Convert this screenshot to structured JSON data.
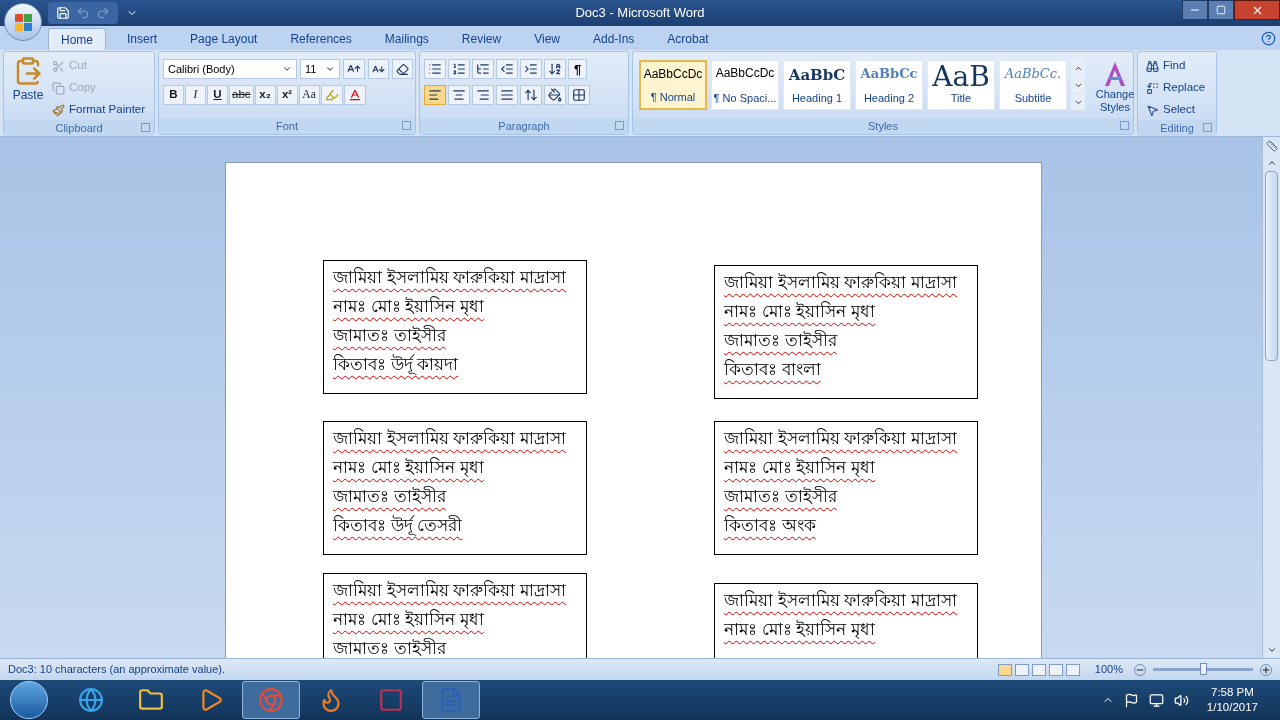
{
  "window": {
    "title": "Doc3 - Microsoft Word"
  },
  "tabs": [
    {
      "label": "Home",
      "selected": true
    },
    {
      "label": "Insert",
      "selected": false
    },
    {
      "label": "Page Layout",
      "selected": false
    },
    {
      "label": "References",
      "selected": false
    },
    {
      "label": "Mailings",
      "selected": false
    },
    {
      "label": "Review",
      "selected": false
    },
    {
      "label": "View",
      "selected": false
    },
    {
      "label": "Add-Ins",
      "selected": false
    },
    {
      "label": "Acrobat",
      "selected": false
    }
  ],
  "clipboard": {
    "label": "Clipboard",
    "paste": "Paste",
    "items": [
      {
        "label": "Cut",
        "disabled": true
      },
      {
        "label": "Copy",
        "disabled": true
      },
      {
        "label": "Format Painter",
        "disabled": false
      }
    ]
  },
  "font": {
    "label": "Font",
    "font_name": "Calibri (Body)",
    "font_size": "11",
    "format_buttons": [
      {
        "kind": "bold",
        "label": "B"
      },
      {
        "kind": "italic",
        "label": "I"
      },
      {
        "kind": "underline",
        "label": "U"
      },
      {
        "kind": "strike",
        "label": "abc"
      },
      {
        "kind": "sub",
        "label": "x₂"
      },
      {
        "kind": "sup",
        "label": "x²"
      },
      {
        "kind": "case",
        "label": "Aa"
      }
    ]
  },
  "paragraph": {
    "label": "Paragraph",
    "show_marks": "¶",
    "alignment": [
      {
        "kind": "left",
        "selected": true
      },
      {
        "kind": "center",
        "selected": false
      },
      {
        "kind": "right",
        "selected": false
      },
      {
        "kind": "justify",
        "selected": false
      }
    ]
  },
  "styles": {
    "label": "Styles",
    "change_styles": "Change Styles",
    "gallery": [
      {
        "preview": "AaBbCcDc",
        "name": "¶ Normal",
        "kind": "normal",
        "selected": true
      },
      {
        "preview": "AaBbCcDc",
        "name": "¶ No Spaci...",
        "kind": "normal",
        "selected": false
      },
      {
        "preview": "AaBbC",
        "name": "Heading 1",
        "kind": "heading1",
        "selected": false
      },
      {
        "preview": "AaBbCc",
        "name": "Heading 2",
        "kind": "heading2",
        "selected": false
      },
      {
        "preview": "AaB",
        "name": "Title",
        "kind": "title",
        "selected": false
      },
      {
        "preview": "AaBbCc.",
        "name": "Subtitle",
        "kind": "subtitle",
        "selected": false
      }
    ]
  },
  "editing": {
    "label": "Editing",
    "items": [
      {
        "kind": "find",
        "label": "Find"
      },
      {
        "kind": "replace",
        "label": "Replace"
      },
      {
        "kind": "select",
        "label": "Select"
      }
    ]
  },
  "document": {
    "spelling_marked": true,
    "text_boxes": [
      {
        "lines": [
          "জামিয়া ইসলামিয় ফারুকিয়া মাদ্রাসা",
          "নামঃ মোঃ ইয়াসিন মৃধা",
          "জামাতঃ তাইসীর",
          "কিতাবঃ উর্দূ কায়দা"
        ]
      },
      {
        "lines": [
          "জামিয়া ইসলামিয় ফারুকিয়া মাদ্রাসা",
          "নামঃ মোঃ ইয়াসিন মৃধা",
          "জামাতঃ তাইসীর",
          "কিতাবঃ বাংলা"
        ]
      },
      {
        "lines": [
          "জামিয়া ইসলামিয় ফারুকিয়া মাদ্রাসা",
          "নামঃ মোঃ ইয়াসিন মৃধা",
          "জামাতঃ তাইসীর",
          "কিতাবঃ উর্দূ তেসরী"
        ]
      },
      {
        "lines": [
          "জামিয়া ইসলামিয় ফারুকিয়া মাদ্রাসা",
          "নামঃ মোঃ ইয়াসিন মৃধা",
          "জামাতঃ তাইসীর",
          "কিতাবঃ অংক"
        ]
      },
      {
        "lines": [
          "জামিয়া ইসলামিয় ফারুকিয়া মাদ্রাসা",
          "নামঃ মোঃ ইয়াসিন মৃধা",
          "জামাতঃ তাইসীর"
        ]
      },
      {
        "lines": [
          "জামিয়া ইসলামিয় ফারুকিয়া মাদ্রাসা",
          "নামঃ মোঃ ইয়াসিন মৃধা"
        ]
      }
    ]
  },
  "status_bar": {
    "text": "Doc3: 10 characters (an approximate value).",
    "zoom": "100%",
    "zoom_level": {
      "level": 0.5
    }
  },
  "taskbar": {
    "time": "7:58 PM",
    "date": "1/10/2017",
    "apps": [
      {
        "kind": "ie",
        "running": false
      },
      {
        "kind": "folder",
        "running": false
      },
      {
        "kind": "media",
        "running": false
      },
      {
        "kind": "chrome",
        "running": true
      },
      {
        "kind": "firefox",
        "running": false
      },
      {
        "kind": "app4",
        "running": false
      },
      {
        "kind": "word",
        "running": true
      }
    ]
  }
}
